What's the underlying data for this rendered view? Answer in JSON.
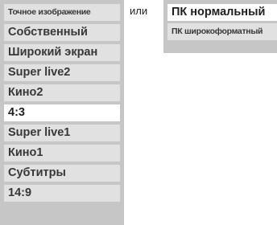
{
  "left_menu": {
    "items": [
      {
        "label": "Точное изображение",
        "selected": false
      },
      {
        "label": "Собственный",
        "selected": false
      },
      {
        "label": "Широкий экран",
        "selected": false
      },
      {
        "label": "Super live2",
        "selected": false
      },
      {
        "label": "Кино2",
        "selected": false
      },
      {
        "label": "4:3",
        "selected": true
      },
      {
        "label": "Super live1",
        "selected": false
      },
      {
        "label": "Кино1",
        "selected": false
      },
      {
        "label": "Субтитры",
        "selected": false
      },
      {
        "label": "14:9",
        "selected": false
      }
    ]
  },
  "separator_text": "или",
  "right_menu": {
    "items": [
      {
        "label": "ПК нормальный",
        "selected": true
      },
      {
        "label": "ПК широкоформатный",
        "selected": false
      }
    ]
  },
  "colors": {
    "menu_bg": "#c6c6c6",
    "item_bg": "#e1e1e1",
    "selected_bg": "#ffffff",
    "text": "#383838"
  }
}
